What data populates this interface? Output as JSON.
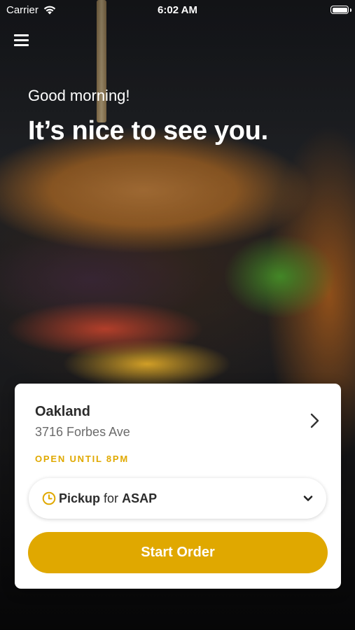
{
  "status_bar": {
    "carrier": "Carrier",
    "time": "6:02 AM"
  },
  "header": {
    "greeting": "Good morning!",
    "headline": "It’s nice to see you."
  },
  "location_card": {
    "name": "Oakland",
    "address": "3716 Forbes Ave",
    "hours": "OPEN UNTIL 8PM",
    "pickup": {
      "mode": "Pickup",
      "connector": "for",
      "time": "ASAP"
    },
    "start_button": "Start Order"
  },
  "icons": [
    "menu-icon",
    "wifi-icon",
    "battery-icon",
    "chevron-right-icon",
    "clock-icon",
    "chevron-down-icon"
  ],
  "colors": {
    "accent": "#e0a800",
    "text_dark": "#2b2b2b",
    "text_muted": "#6b6b6b",
    "card_bg": "#ffffff"
  }
}
